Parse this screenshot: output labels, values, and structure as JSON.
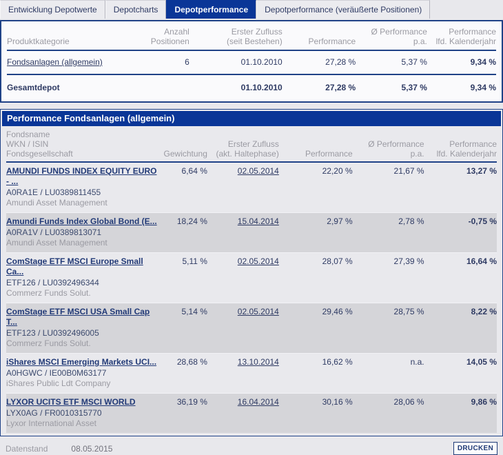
{
  "colors": {
    "brand_navy": "#0a3697",
    "border_navy": "#1f4287",
    "text_navy": "#2e3a63",
    "gray_text": "#9a9aa2",
    "row_alt": "#d5d5d9",
    "panel_bg": "#e9e9ed"
  },
  "tabs": [
    {
      "label": "Entwicklung Depotwerte",
      "active": false
    },
    {
      "label": "Depotcharts",
      "active": false
    },
    {
      "label": "Depotperformance",
      "active": true
    },
    {
      "label": "Depotperformance (veräußerte Positionen)",
      "active": false
    }
  ],
  "summary_table": {
    "headers": [
      "Produktkategorie",
      "Anzahl\nPositionen",
      "Erster Zufluss\n(seit Bestehen)",
      "Performance",
      "Ø Performance\np.a.",
      "Performance\nlfd. Kalenderjahr"
    ],
    "rows": [
      {
        "category": "Fondsanlagen (allgemein)",
        "positions": "6",
        "inflow": "01.10.2010",
        "performance": "27,28 %",
        "performance_pa": "5,37 %",
        "performance_ytd": "9,34 %"
      },
      {
        "category": "Gesamtdepot",
        "positions": "",
        "inflow": "01.10.2010",
        "performance": "27,28 %",
        "performance_pa": "5,37 %",
        "performance_ytd": "9,34 %"
      }
    ]
  },
  "fund_section": {
    "title": "Performance Fondsanlagen (allgemein)",
    "headers": [
      "Fondsname\nWKN / ISIN\nFondsgesellschaft",
      "Gewichtung",
      "Erster Zufluss\n(akt. Haltephase)",
      "Performance",
      "Ø Performance\np.a.",
      "Performance\nlfd. Kalenderjahr"
    ],
    "rows": [
      {
        "name": "AMUNDI FUNDS INDEX EQUITY EURO - ...",
        "wkn_isin": "A0RA1E / LU0389811455",
        "company": "Amundi Asset Management",
        "weight": "6,64 %",
        "inflow": "02.05.2014",
        "performance": "22,20 %",
        "performance_pa": "21,67 %",
        "performance_ytd": "13,27 %"
      },
      {
        "name": "Amundi Funds Index Global Bond (E...",
        "wkn_isin": "A0RA1V / LU0389813071",
        "company": "Amundi Asset Management",
        "weight": "18,24 %",
        "inflow": "15.04.2014",
        "performance": "2,97 %",
        "performance_pa": "2,78 %",
        "performance_ytd": "-0,75 %"
      },
      {
        "name": "ComStage ETF MSCI Europe Small Ca...",
        "wkn_isin": "ETF126 / LU0392496344",
        "company": "Commerz Funds Solut.",
        "weight": "5,11 %",
        "inflow": "02.05.2014",
        "performance": "28,07 %",
        "performance_pa": "27,39 %",
        "performance_ytd": "16,64 %"
      },
      {
        "name": "ComStage ETF MSCI USA Small Cap T...",
        "wkn_isin": "ETF123 / LU0392496005",
        "company": "Commerz Funds Solut.",
        "weight": "5,14 %",
        "inflow": "02.05.2014",
        "performance": "29,46 %",
        "performance_pa": "28,75 %",
        "performance_ytd": "8,22 %"
      },
      {
        "name": "iShares MSCI Emerging Markets UCI...",
        "wkn_isin": "A0HGWC / IE00B0M63177",
        "company": "iShares Public Ldt Company",
        "weight": "28,68 %",
        "inflow": "13.10.2014",
        "performance": "16,62 %",
        "performance_pa": "n.a.",
        "performance_ytd": "14,05 %"
      },
      {
        "name": "LYXOR UCITS ETF MSCI WORLD",
        "wkn_isin": "LYX0AG / FR0010315770",
        "company": "Lyxor International Asset",
        "weight": "36,19 %",
        "inflow": "16.04.2014",
        "performance": "30,16 %",
        "performance_pa": "28,06 %",
        "performance_ytd": "9,86 %"
      }
    ]
  },
  "footer": {
    "label": "Datenstand",
    "date": "08.05.2015",
    "print_button": "DRUCKEN"
  }
}
